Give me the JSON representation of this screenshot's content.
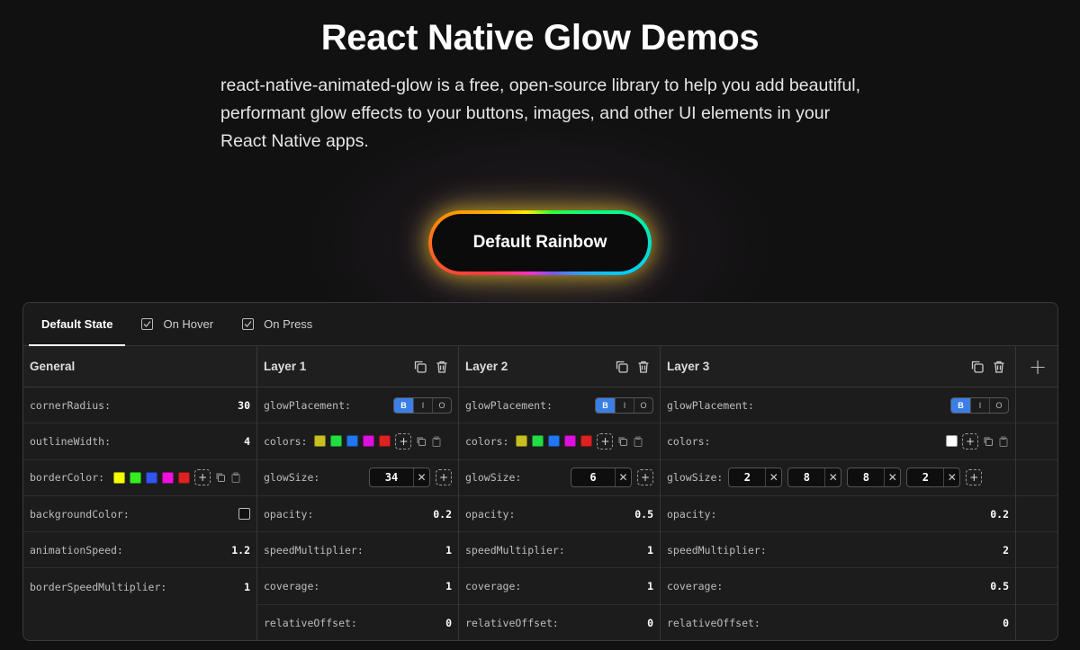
{
  "hero": {
    "title": "React Native Glow Demos",
    "description": "react-native-animated-glow is a free, open-source library to help you add beautiful, performant glow effects to your buttons, images, and other UI elements in your React Native apps.",
    "demo_button_label": "Default Rainbow"
  },
  "tabs": [
    {
      "label": "Default State",
      "active": true
    },
    {
      "label": "On Hover",
      "active": false
    },
    {
      "label": "On Press",
      "active": false
    }
  ],
  "general": {
    "title": "General",
    "rows": [
      {
        "label": "cornerRadius:",
        "value": "30"
      },
      {
        "label": "outlineWidth:",
        "value": "4"
      },
      {
        "label": "borderColor:",
        "swatches": [
          "#f6ff00",
          "#33ee22",
          "#3355ee",
          "#ee11dd",
          "#dd2222"
        ]
      },
      {
        "label": "backgroundColor:"
      },
      {
        "label": "animationSpeed:",
        "value": "1.2"
      },
      {
        "label": "borderSpeedMultiplier:",
        "value": "1"
      }
    ]
  },
  "layers": [
    {
      "title": "Layer 1",
      "placement": [
        "B",
        "I",
        "O"
      ],
      "colors": [
        "#c8c020",
        "#22dd44",
        "#2277ee",
        "#dd11dd",
        "#dd2222"
      ],
      "glowSize": [
        "34"
      ],
      "rows": {
        "glowPlacement": "glowPlacement:",
        "colors": "colors:",
        "glowSize": "glowSize:",
        "opacity": "opacity:",
        "opacity_v": "0.2",
        "speedMultiplier": "speedMultiplier:",
        "speedMultiplier_v": "1",
        "coverage": "coverage:",
        "coverage_v": "1",
        "relativeOffset": "relativeOffset:",
        "relativeOffset_v": "0"
      }
    },
    {
      "title": "Layer 2",
      "placement": [
        "B",
        "I",
        "O"
      ],
      "colors": [
        "#c8c020",
        "#22dd44",
        "#2277ee",
        "#dd11dd",
        "#dd2222"
      ],
      "glowSize": [
        "6"
      ],
      "rows": {
        "glowPlacement": "glowPlacement:",
        "colors": "colors:",
        "glowSize": "glowSize:",
        "opacity": "opacity:",
        "opacity_v": "0.5",
        "speedMultiplier": "speedMultiplier:",
        "speedMultiplier_v": "1",
        "coverage": "coverage:",
        "coverage_v": "1",
        "relativeOffset": "relativeOffset:",
        "relativeOffset_v": "0"
      }
    },
    {
      "title": "Layer 3",
      "placement": [
        "B",
        "I",
        "O"
      ],
      "colors": [
        "#ffffff"
      ],
      "glowSize": [
        "2",
        "8",
        "8",
        "2"
      ],
      "rows": {
        "glowPlacement": "glowPlacement:",
        "colors": "colors:",
        "glowSize": "glowSize:",
        "opacity": "opacity:",
        "opacity_v": "0.2",
        "speedMultiplier": "speedMultiplier:",
        "speedMultiplier_v": "2",
        "coverage": "coverage:",
        "coverage_v": "0.5",
        "relativeOffset": "relativeOffset:",
        "relativeOffset_v": "0"
      }
    }
  ],
  "add_layer_label": "+",
  "colors": {
    "background": "#111111",
    "accent": "#3b7fe6"
  }
}
